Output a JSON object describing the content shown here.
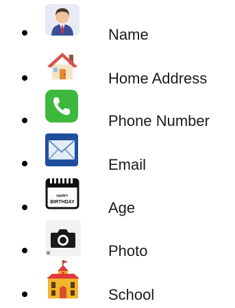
{
  "items": [
    {
      "icon": "person-avatar-icon",
      "label": "Name"
    },
    {
      "icon": "house-icon",
      "label": "Home Address"
    },
    {
      "icon": "phone-icon",
      "label": "Phone Number"
    },
    {
      "icon": "envelope-icon",
      "label": "Email"
    },
    {
      "icon": "birthday-calendar-icon",
      "label": "Age",
      "icon_text": "HAPPY BIRTHDAY"
    },
    {
      "icon": "camera-icon",
      "label": "Photo"
    },
    {
      "icon": "school-building-icon",
      "label": "School"
    }
  ],
  "colors": {
    "text": "#1a1a1a",
    "phone_green": "#3cb93c",
    "mail_blue": "#1f4f9c",
    "house_red": "#d9534f",
    "school_yellow": "#f0b52a"
  }
}
